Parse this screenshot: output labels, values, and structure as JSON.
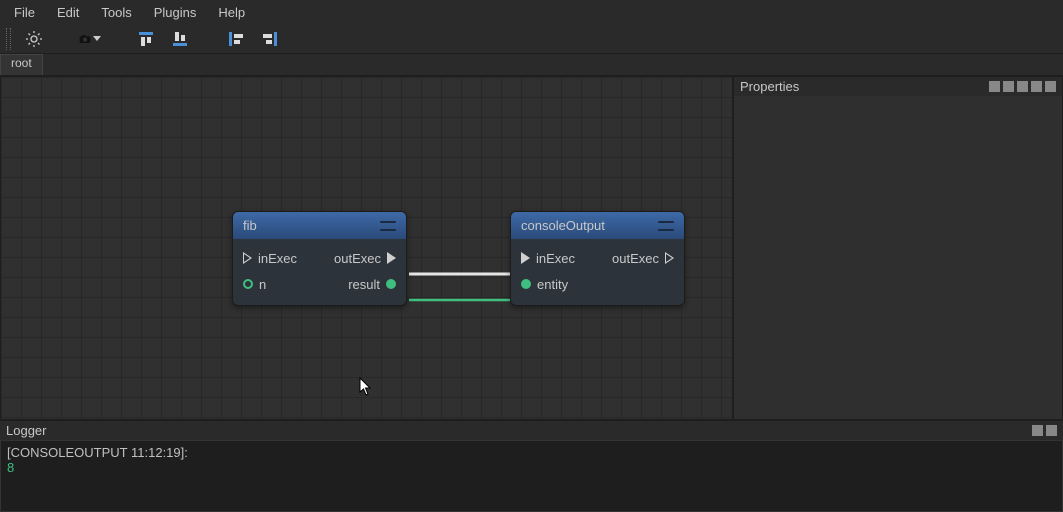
{
  "menubar": {
    "items": [
      "File",
      "Edit",
      "Tools",
      "Plugins",
      "Help"
    ]
  },
  "tabs": {
    "root": "root"
  },
  "nodes": {
    "fib": {
      "title": "fib",
      "in1": "inExec",
      "out1": "outExec",
      "in2": "n",
      "out2": "result"
    },
    "console": {
      "title": "consoleOutput",
      "in1": "inExec",
      "out1": "outExec",
      "in2": "entity"
    }
  },
  "properties": {
    "title": "Properties"
  },
  "logger": {
    "title": "Logger",
    "line1": "[CONSOLEOUTPUT 11:12:19]:",
    "line2": "8"
  }
}
